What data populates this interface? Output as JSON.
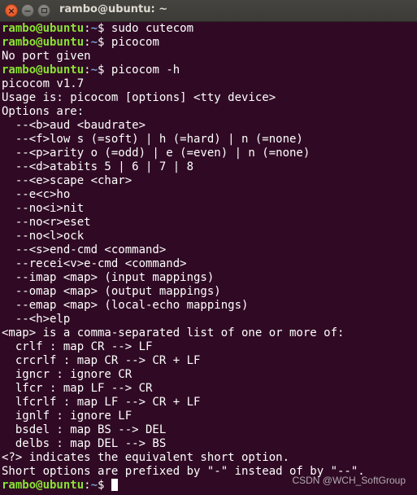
{
  "window": {
    "title": "rambo@ubuntu: ~",
    "close_glyph": "×",
    "minimize_glyph": "−"
  },
  "prompt": {
    "user_host": "rambo@ubuntu",
    "colon": ":",
    "path": "~",
    "dollar": "$"
  },
  "terminal": {
    "lines": [
      {
        "type": "prompt",
        "cmd": " sudo cutecom"
      },
      {
        "type": "prompt",
        "cmd": " picocom"
      },
      {
        "type": "text",
        "text": "No port given"
      },
      {
        "type": "prompt",
        "cmd": " picocom -h"
      },
      {
        "type": "text",
        "text": "picocom v1.7"
      },
      {
        "type": "text",
        "text": "Usage is: picocom [options] <tty device>"
      },
      {
        "type": "text",
        "text": "Options are:"
      },
      {
        "type": "text",
        "text": "  --<b>aud <baudrate>"
      },
      {
        "type": "text",
        "text": "  --<f>low s (=soft) | h (=hard) | n (=none)"
      },
      {
        "type": "text",
        "text": "  --<p>arity o (=odd) | e (=even) | n (=none)"
      },
      {
        "type": "text",
        "text": "  --<d>atabits 5 | 6 | 7 | 8"
      },
      {
        "type": "text",
        "text": "  --<e>scape <char>"
      },
      {
        "type": "text",
        "text": "  --e<c>ho"
      },
      {
        "type": "text",
        "text": "  --no<i>nit"
      },
      {
        "type": "text",
        "text": "  --no<r>eset"
      },
      {
        "type": "text",
        "text": "  --no<l>ock"
      },
      {
        "type": "text",
        "text": "  --<s>end-cmd <command>"
      },
      {
        "type": "text",
        "text": "  --recei<v>e-cmd <command>"
      },
      {
        "type": "text",
        "text": "  --imap <map> (input mappings)"
      },
      {
        "type": "text",
        "text": "  --omap <map> (output mappings)"
      },
      {
        "type": "text",
        "text": "  --emap <map> (local-echo mappings)"
      },
      {
        "type": "text",
        "text": "  --<h>elp"
      },
      {
        "type": "text",
        "text": "<map> is a comma-separated list of one or more of:"
      },
      {
        "type": "text",
        "text": "  crlf : map CR --> LF"
      },
      {
        "type": "text",
        "text": "  crcrlf : map CR --> CR + LF"
      },
      {
        "type": "text",
        "text": "  igncr : ignore CR"
      },
      {
        "type": "text",
        "text": "  lfcr : map LF --> CR"
      },
      {
        "type": "text",
        "text": "  lfcrlf : map LF --> CR + LF"
      },
      {
        "type": "text",
        "text": "  ignlf : ignore LF"
      },
      {
        "type": "text",
        "text": "  bsdel : map BS --> DEL"
      },
      {
        "type": "text",
        "text": "  delbs : map DEL --> BS"
      },
      {
        "type": "text",
        "text": "<?> indicates the equivalent short option."
      },
      {
        "type": "text",
        "text": "Short options are prefixed by \"-\" instead of by \"--\"."
      },
      {
        "type": "prompt",
        "cmd": " ",
        "cursor": true
      }
    ]
  },
  "watermark": "CSDN @WCH_SoftGroup"
}
